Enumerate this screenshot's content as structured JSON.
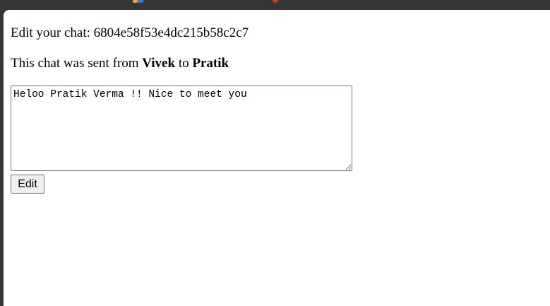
{
  "page": {
    "title_prefix": "Edit your chat:",
    "chat_id": "6804e58f53e4dc215b58c2c7"
  },
  "info": {
    "prefix": "This chat was sent from",
    "sender": "Vivek",
    "connector": "to",
    "receiver": "Pratik"
  },
  "form": {
    "message_value": "Heloo Pratik Verma !! Nice to meet you",
    "submit_label": "Edit"
  },
  "colors": {
    "chrome_background": "#353535",
    "page_background": "#ffffff",
    "field_border": "#767676",
    "button_background": "#efefef",
    "chrome_tab_icon_orange": "#f0a030",
    "chrome_tab_icon_blue": "#3b78d8",
    "chrome_tab_icon_red": "#d23c2e"
  }
}
